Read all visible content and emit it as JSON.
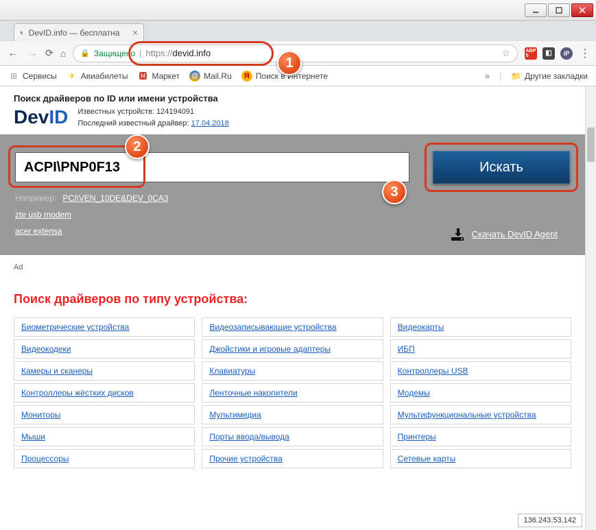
{
  "window": {
    "tab_title": "DevID.info — бесплатна",
    "secure_label": "Защищено",
    "url_scheme": "https://",
    "url_host": "devid.info"
  },
  "bookmarks": {
    "apps": "Сервисы",
    "avia": "Авиабилеты",
    "market": "Маркет",
    "mail": "Mail.Ru",
    "search": "Поиск в Интернете",
    "other": "Другие закладки"
  },
  "site": {
    "subtitle": "Поиск драйверов по ID или имени устройства",
    "logo_dev": "Dev",
    "logo_id": "ID",
    "known_devices_label": "Известных устройств:",
    "known_devices_value": "124194091",
    "last_driver_label": "Последний известный драйвер:",
    "last_driver_value": "17.04.2018"
  },
  "search": {
    "value": "ACPI\\PNP0F13",
    "button": "Искать",
    "example_label": "Например:",
    "examples": [
      "PCI\\VEN_10DE&DEV_0CA3",
      "zte usb modem",
      "acer extensa"
    ],
    "download_agent": "Скачать DevID Agent"
  },
  "markers": {
    "m1": "1",
    "m2": "2",
    "m3": "3"
  },
  "ad_label": "Ad",
  "section_title": "Поиск драйверов по типу устройства:",
  "categories": [
    [
      "Биометрические устройства",
      "Видеозаписывающие устройства",
      "Видеокарты"
    ],
    [
      "Видеокодеки",
      "Джойстики и игровые адаптеры",
      "ИБП"
    ],
    [
      "Камеры и сканеры",
      "Клавиатуры",
      "Контроллеры USB"
    ],
    [
      "Контроллеры жёстких дисков",
      "Ленточные накопители",
      "Модемы"
    ],
    [
      "Мониторы",
      "Мультимедиа",
      "Мультифункциональные устройства"
    ],
    [
      "Мыши",
      "Порты ввода/вывода",
      "Принтеры"
    ],
    [
      "Процессоры",
      "Прочие устройства",
      "Сетевые карты"
    ]
  ],
  "ip_badge": "136.243.53.142"
}
